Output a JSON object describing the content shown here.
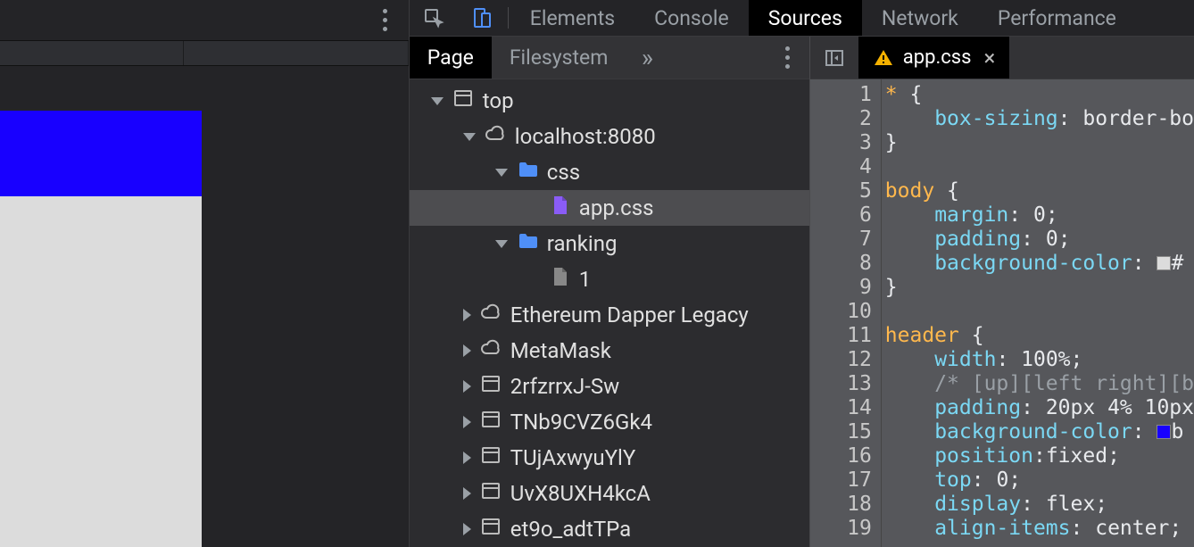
{
  "devtools": {
    "tabs": [
      "Elements",
      "Console",
      "Sources",
      "Network",
      "Performance"
    ],
    "active_tab": "Sources"
  },
  "navigator": {
    "tabs": [
      "Page",
      "Filesystem"
    ],
    "active_tab": "Page",
    "tree": [
      {
        "depth": 0,
        "arrow": "down",
        "icon": "frame",
        "label": "top"
      },
      {
        "depth": 1,
        "arrow": "down",
        "icon": "cloud",
        "label": "localhost:8080"
      },
      {
        "depth": 2,
        "arrow": "down",
        "icon": "folder",
        "label": "css"
      },
      {
        "depth": 3,
        "arrow": "none",
        "icon": "cssfile",
        "label": "app.css",
        "selected": true
      },
      {
        "depth": 2,
        "arrow": "down",
        "icon": "folder",
        "label": "ranking"
      },
      {
        "depth": 3,
        "arrow": "none",
        "icon": "file",
        "label": "1"
      },
      {
        "depth": 1,
        "arrow": "right",
        "icon": "cloud",
        "label": "Ethereum Dapper Legacy"
      },
      {
        "depth": 1,
        "arrow": "right",
        "icon": "cloud",
        "label": "MetaMask"
      },
      {
        "depth": 1,
        "arrow": "right",
        "icon": "frame",
        "label": "2rfzrrxJ-Sw"
      },
      {
        "depth": 1,
        "arrow": "right",
        "icon": "frame",
        "label": "TNb9CVZ6Gk4"
      },
      {
        "depth": 1,
        "arrow": "right",
        "icon": "frame",
        "label": "TUjAxwyuYlY"
      },
      {
        "depth": 1,
        "arrow": "right",
        "icon": "frame",
        "label": "UvX8UXH4kcA"
      },
      {
        "depth": 1,
        "arrow": "right",
        "icon": "frame",
        "label": "et9o_adtTPa"
      }
    ]
  },
  "open_file": {
    "name": "app.css",
    "has_warning": true
  },
  "code": {
    "lines": [
      {
        "n": 1,
        "t": [
          [
            "sel",
            "*"
          ],
          [
            "punct",
            " {"
          ]
        ]
      },
      {
        "n": 2,
        "t": [
          [
            "indent",
            "    "
          ],
          [
            "prop",
            "box-sizing"
          ],
          [
            "punct",
            ": "
          ],
          [
            "val",
            "border-bo"
          ]
        ]
      },
      {
        "n": 3,
        "t": [
          [
            "punct",
            "}"
          ]
        ]
      },
      {
        "n": 4,
        "t": []
      },
      {
        "n": 5,
        "t": [
          [
            "sel",
            "body"
          ],
          [
            "punct",
            " {"
          ]
        ]
      },
      {
        "n": 6,
        "t": [
          [
            "indent",
            "    "
          ],
          [
            "prop",
            "margin"
          ],
          [
            "punct",
            ": "
          ],
          [
            "val",
            "0"
          ],
          [
            "punct",
            ";"
          ]
        ]
      },
      {
        "n": 7,
        "t": [
          [
            "indent",
            "    "
          ],
          [
            "prop",
            "padding"
          ],
          [
            "punct",
            ": "
          ],
          [
            "val",
            "0"
          ],
          [
            "punct",
            ";"
          ]
        ]
      },
      {
        "n": 8,
        "t": [
          [
            "indent",
            "    "
          ],
          [
            "prop",
            "background-color"
          ],
          [
            "punct",
            ": "
          ],
          [
            "swatch",
            "#dcdcdc"
          ],
          [
            "val",
            "#"
          ]
        ]
      },
      {
        "n": 9,
        "t": [
          [
            "punct",
            "}"
          ]
        ]
      },
      {
        "n": 10,
        "t": []
      },
      {
        "n": 11,
        "t": [
          [
            "sel",
            "header"
          ],
          [
            "punct",
            " {"
          ]
        ]
      },
      {
        "n": 12,
        "t": [
          [
            "indent",
            "    "
          ],
          [
            "prop",
            "width"
          ],
          [
            "punct",
            ": "
          ],
          [
            "val",
            "100%"
          ],
          [
            "punct",
            ";"
          ]
        ]
      },
      {
        "n": 13,
        "t": [
          [
            "indent",
            "    "
          ],
          [
            "comment",
            "/* [up][left right][b"
          ]
        ]
      },
      {
        "n": 14,
        "t": [
          [
            "indent",
            "    "
          ],
          [
            "prop",
            "padding"
          ],
          [
            "punct",
            ": "
          ],
          [
            "val",
            "20px 4% 10px"
          ]
        ]
      },
      {
        "n": 15,
        "t": [
          [
            "indent",
            "    "
          ],
          [
            "prop",
            "background-color"
          ],
          [
            "punct",
            ": "
          ],
          [
            "swatch",
            "#1800ff"
          ],
          [
            "val",
            "b"
          ]
        ]
      },
      {
        "n": 16,
        "t": [
          [
            "indent",
            "    "
          ],
          [
            "prop",
            "position"
          ],
          [
            "punct",
            ":"
          ],
          [
            "val",
            "fixed"
          ],
          [
            "punct",
            ";"
          ]
        ]
      },
      {
        "n": 17,
        "t": [
          [
            "indent",
            "    "
          ],
          [
            "prop",
            "top"
          ],
          [
            "punct",
            ": "
          ],
          [
            "val",
            "0"
          ],
          [
            "punct",
            ";"
          ]
        ]
      },
      {
        "n": 18,
        "t": [
          [
            "indent",
            "    "
          ],
          [
            "prop",
            "display"
          ],
          [
            "punct",
            ": "
          ],
          [
            "val",
            "flex"
          ],
          [
            "punct",
            ";"
          ]
        ]
      },
      {
        "n": 19,
        "t": [
          [
            "indent",
            "    "
          ],
          [
            "prop",
            "align-items"
          ],
          [
            "punct",
            ": "
          ],
          [
            "val",
            "center"
          ],
          [
            "punct",
            ";"
          ]
        ]
      }
    ]
  },
  "colors": {
    "preview_header": "#1800ff",
    "preview_body": "#dcdcdc"
  }
}
